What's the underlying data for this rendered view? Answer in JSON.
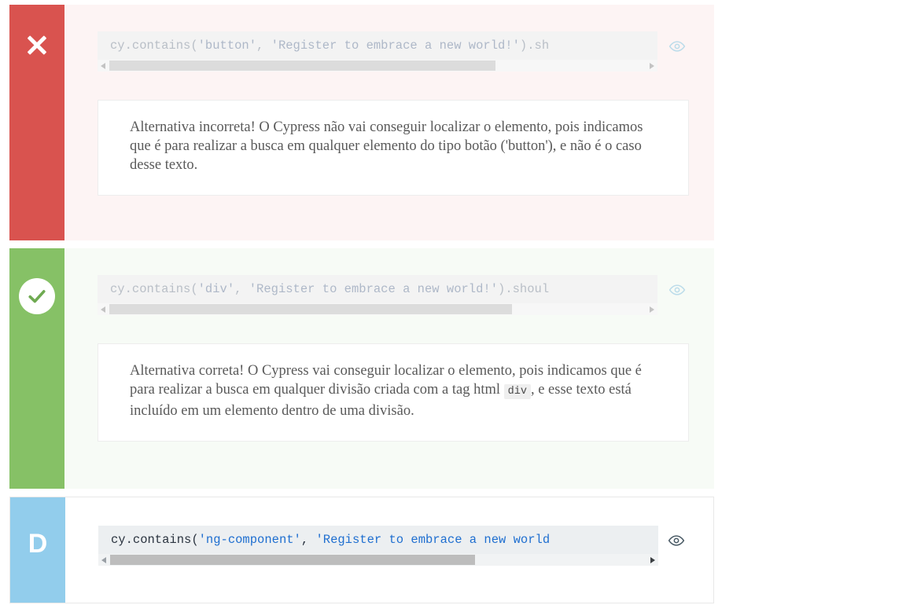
{
  "alternatives": [
    {
      "id": "alt-a",
      "marker": {
        "type": "x-icon",
        "label": ""
      },
      "state": "incorrect",
      "code": {
        "prefix": "cy.contains(",
        "arg1": "'button'",
        "sep": ", ",
        "arg2": "'Register to embrace a new world!'",
        "suffix": ").sh",
        "full_visible": "cy.contains('button', 'Register to embrace a new world!').sh",
        "faded": true,
        "scroll_thumb_percent": 72
      },
      "eye_icon": "eye-icon",
      "explanation_parts": [
        {
          "type": "text",
          "value": "Alternativa incorreta! O Cypress não vai conseguir localizar o elemento, pois indicamos que é para realizar a busca em qualquer elemento do tipo botão ('button'), e não é o caso desse texto."
        }
      ]
    },
    {
      "id": "alt-b",
      "marker": {
        "type": "check-circle-icon",
        "label": ""
      },
      "state": "correct",
      "code": {
        "prefix": "cy.contains(",
        "arg1": "'div'",
        "sep": ", ",
        "arg2": "'Register to embrace a new world!'",
        "suffix": ").shoul",
        "full_visible": "cy.contains('div', 'Register to embrace a new world!').shoul",
        "faded": true,
        "scroll_thumb_percent": 75
      },
      "eye_icon": "eye-icon",
      "explanation_parts": [
        {
          "type": "text",
          "value": "Alternativa correta! O Cypress vai conseguir localizar o elemento, pois indicamos que é para realizar a busca em qualquer divisão criada com a tag html "
        },
        {
          "type": "code",
          "value": "div"
        },
        {
          "type": "text",
          "value": ", e esse texto está incluído em um elemento dentro de uma divisão."
        }
      ]
    },
    {
      "id": "alt-d",
      "marker": {
        "type": "letter",
        "label": "D"
      },
      "state": "neutral",
      "code": {
        "prefix": "cy.contains(",
        "arg1": "'ng-component'",
        "sep": ", ",
        "arg2": "'Register to embrace a new world",
        "suffix": "",
        "full_visible": "cy.contains('ng-component', 'Register to embrace a new world",
        "faded": false,
        "scroll_thumb_percent": 68
      },
      "eye_icon": "eye-icon",
      "explanation_parts": []
    }
  ],
  "colors": {
    "incorrect_marker": "#d9534f",
    "incorrect_bg": "#fdf4f4",
    "correct_marker": "#86c166",
    "correct_bg": "#f7fbf6",
    "neutral_marker": "#92cdec",
    "neutral_bg": "#ffffff",
    "code_string_active": "#1f6fd0",
    "code_plain_active": "#2b3440",
    "code_faded": "#b9bfc7",
    "eye_faded": "#bcdcea",
    "eye_active": "#4a5b66"
  }
}
